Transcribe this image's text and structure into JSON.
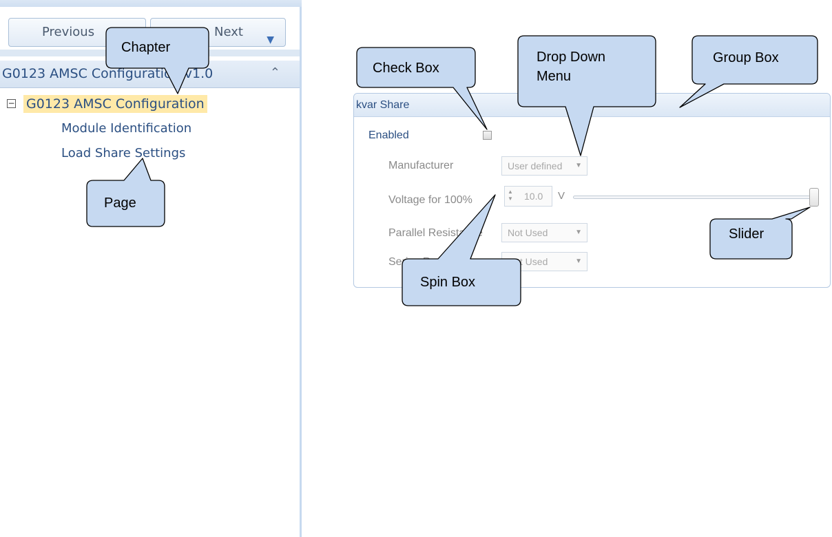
{
  "nav": {
    "previous_label": "Previous",
    "next_label": "Next",
    "next_icon": "chevron-down-icon",
    "chapter_title": "G0123 AMSC Configuration v1.0",
    "collapse_icon": "double-chevron-up-icon",
    "tree": {
      "root_label": "G0123 AMSC Configuration",
      "expander_symbol": "⊟",
      "pages": [
        "Module Identification",
        "Load Share Settings"
      ]
    }
  },
  "group": {
    "title": "kvar Share",
    "enabled_label": "Enabled",
    "enabled_checked": false,
    "manufacturer_label": "Manufacturer",
    "manufacturer_value": "User defined",
    "voltage_label": "Voltage for 100%",
    "voltage_value": "10.0",
    "voltage_unit": "V",
    "slider_level": 1.0,
    "parallel_label": "Parallel Resistance",
    "parallel_value": "Not Used",
    "series_label": "Series Resistance",
    "series_value": "Not Used"
  },
  "callouts": {
    "chapter": "Chapter",
    "page": "Page",
    "check_box": "Check Box",
    "drop_down_line1": "Drop Down",
    "drop_down_line2": "Menu",
    "group_box": "Group Box",
    "spin_box": "Spin Box",
    "slider": "Slider"
  },
  "colors": {
    "accent_text": "#2b4f82",
    "callout_fill": "#c6d9f1",
    "selection_highlight": "#ffe9a8"
  }
}
